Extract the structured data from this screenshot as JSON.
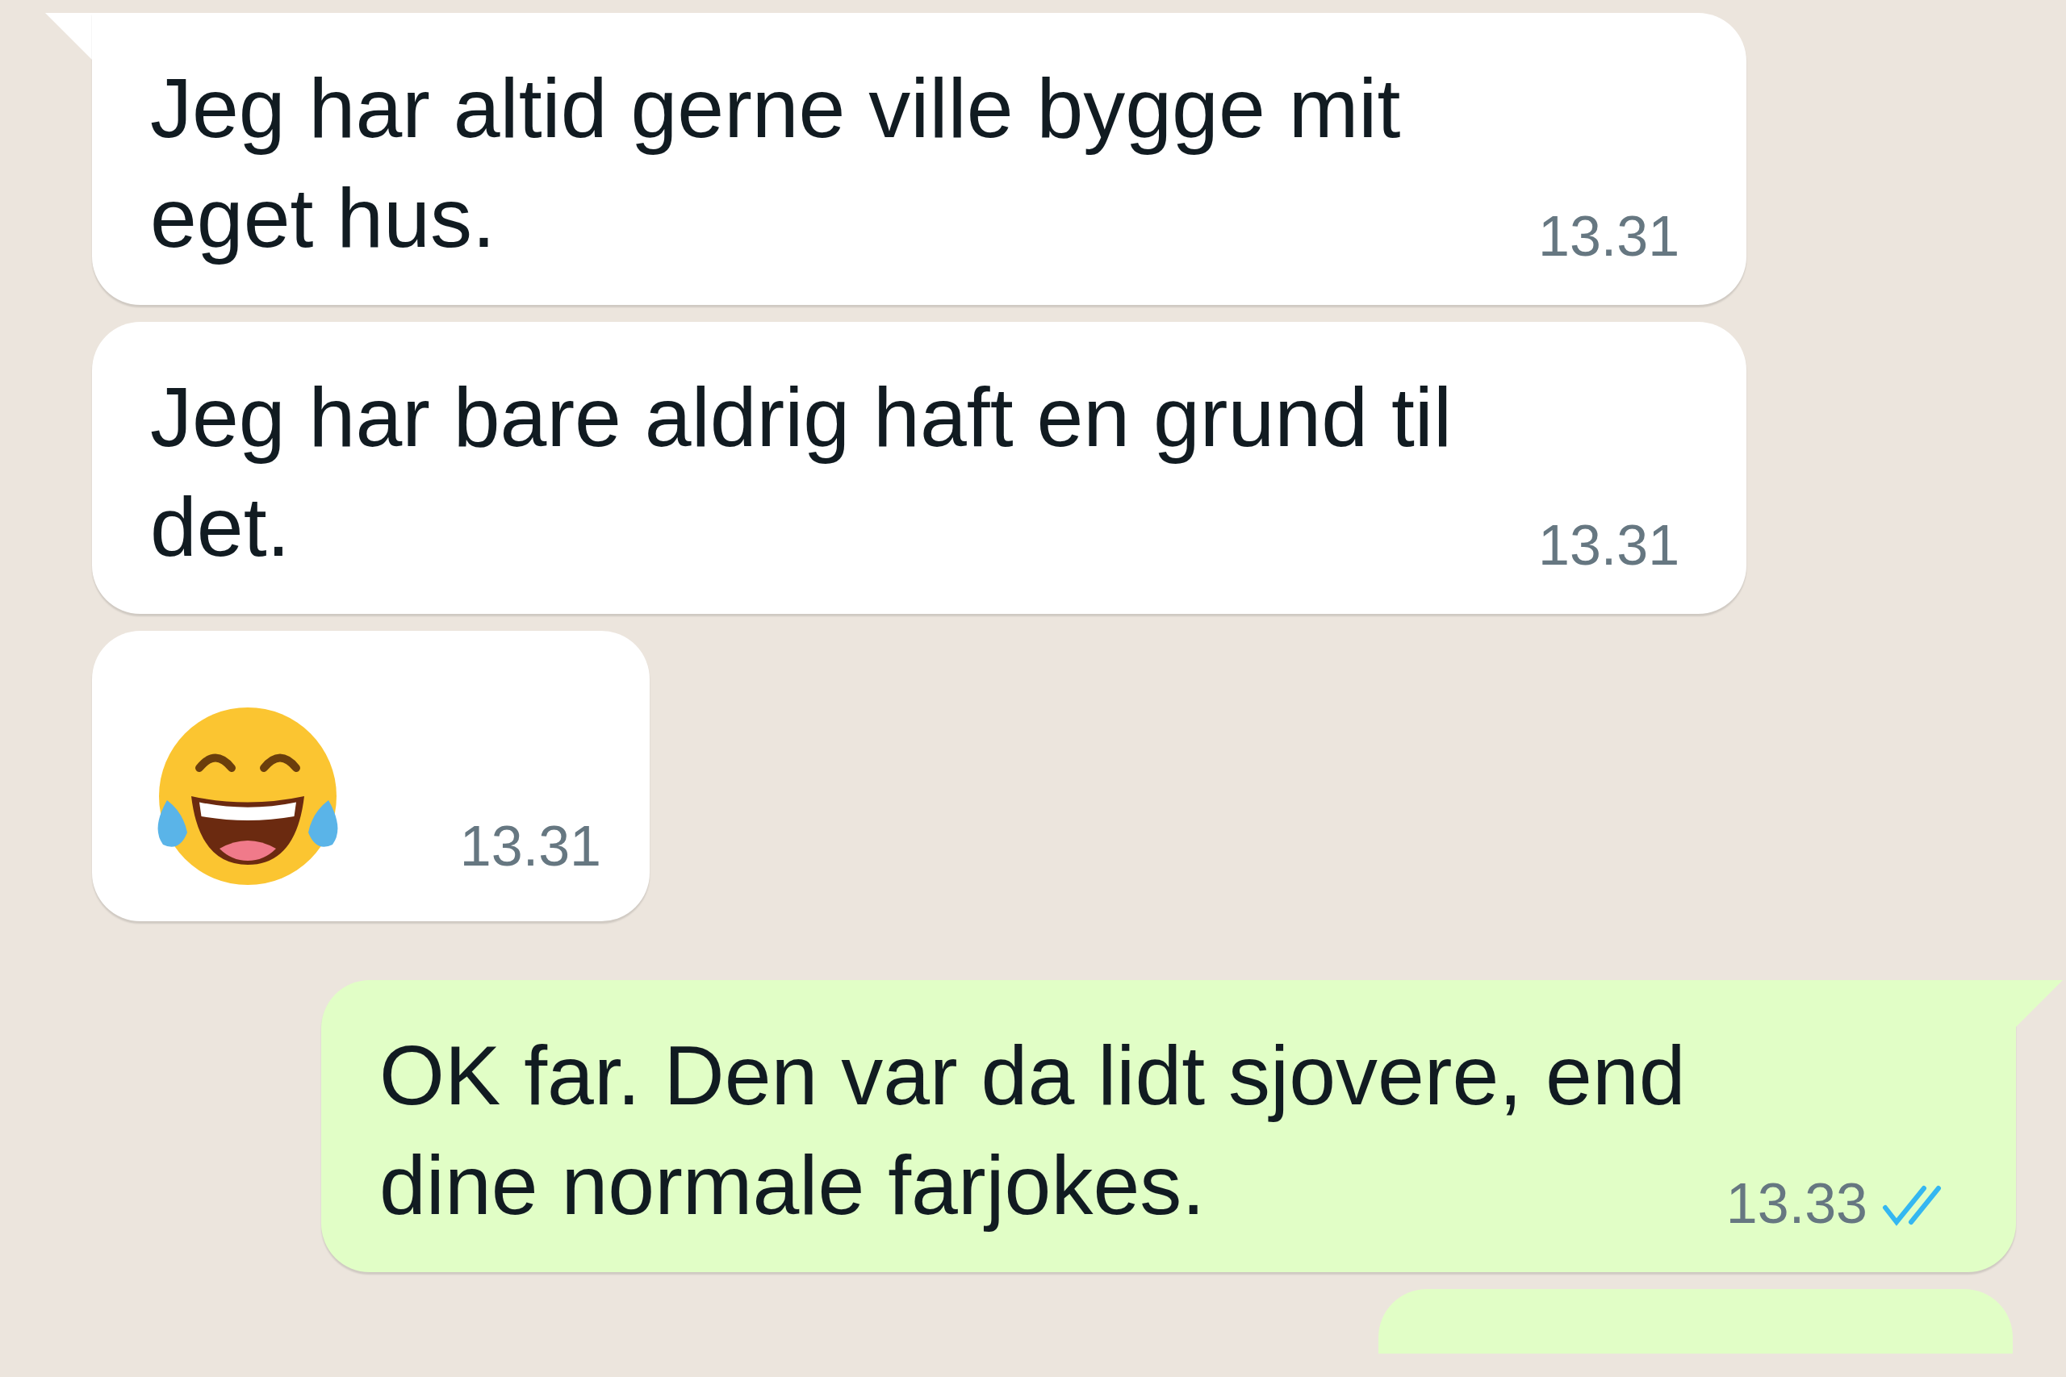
{
  "messages": [
    {
      "kind": "text",
      "outgoing": false,
      "text": "Jeg har altid gerne ville bygge mit eget hus.",
      "time": "13.31",
      "tail": true
    },
    {
      "kind": "text",
      "outgoing": false,
      "text": "Jeg har bare aldrig haft en grund til det.",
      "time": "13.31",
      "tail": false
    },
    {
      "kind": "emoji",
      "outgoing": false,
      "time": "13.31",
      "tail": false
    },
    {
      "kind": "text",
      "outgoing": true,
      "text": "OK far. Den var da lidt sjovere, end dine normale farjokes.",
      "time": "13.33",
      "tail": true,
      "read": true
    },
    {
      "kind": "partial",
      "outgoing": true
    }
  ]
}
